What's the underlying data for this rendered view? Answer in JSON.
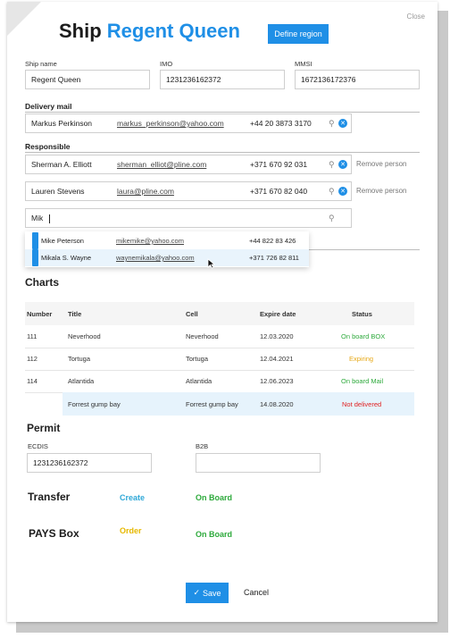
{
  "header": {
    "title_prefix": "Ship",
    "title_name": "Regent Queen",
    "define_region": "Define region",
    "close": "Close"
  },
  "ship": {
    "name_label": "Ship name",
    "name_value": "Regent Queen",
    "imo_label": "IMO",
    "imo_value": "1231236162372",
    "mmsi_label": "MMSI",
    "mmsi_value": "1672136172376"
  },
  "delivery": {
    "section": "Delivery mail",
    "name": "Markus Perkinson",
    "email": "markus_perkinson@yahoo.com",
    "phone": "+44 20 3873 3170"
  },
  "responsible": {
    "section": "Responsible",
    "people": [
      {
        "name": "Sherman A. Elliott",
        "email": "sherman_elliot@pline.com",
        "phone": "+371 670 92 031",
        "remove": "Remove person"
      },
      {
        "name": "Lauren Stevens",
        "email": "laura@pline.com",
        "phone": "+371 670 82 040",
        "remove": "Remove person"
      }
    ],
    "search_value": "Mik"
  },
  "dropdown": [
    {
      "name": "Mike Peterson",
      "email": "mikemike@yahoo.com",
      "phone": "+44 822 83 426"
    },
    {
      "name": "Mikala S. Wayne",
      "email": "waynemikala@yahoo.com",
      "phone": "+371 726 82 811"
    }
  ],
  "charts": {
    "heading": "Charts",
    "columns": [
      "Number",
      "Title",
      "Cell",
      "Expire date",
      "Status"
    ],
    "rows": [
      {
        "number": "111",
        "title": "Neverhood",
        "cell": "Neverhood",
        "date": "12.03.2020",
        "status": "On board BOX",
        "color": "#2eaa3c"
      },
      {
        "number": "112",
        "title": "Tortuga",
        "cell": "Tortuga",
        "date": "12.04.2021",
        "status": "Expiring",
        "color": "#e6a817"
      },
      {
        "number": "114",
        "title": "Atlantida",
        "cell": "Atlantida",
        "date": "12.06.2023",
        "status": "On board Mail",
        "color": "#2eaa3c"
      },
      {
        "number": "",
        "title": "Forrest gump bay",
        "cell": "Forrest gump bay",
        "date": "14.08.2020",
        "status": "Not delivered",
        "color": "#e02020"
      }
    ]
  },
  "permit": {
    "heading": "Permit",
    "ecdis_label": "ECDIS",
    "ecdis_value": "1231236162372",
    "b2b_label": "B2B",
    "b2b_value": ""
  },
  "transfer": {
    "label": "Transfer",
    "create": "Create",
    "status": "On Board"
  },
  "pays": {
    "label": "PAYS Box",
    "order": "Order",
    "status": "On Board"
  },
  "footer": {
    "save": "Save",
    "cancel": "Cancel"
  },
  "colors": {
    "accent": "#1f8fe6",
    "create": "#2fa8d8",
    "order": "#e6b800",
    "onboard": "#2eaa3c"
  }
}
